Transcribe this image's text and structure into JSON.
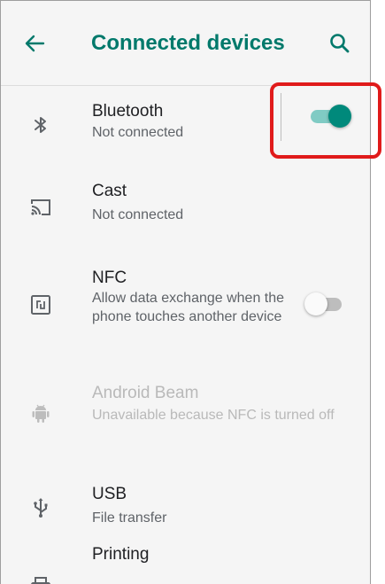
{
  "app_bar": {
    "title": "Connected devices",
    "back_icon": "arrow-back-icon",
    "search_icon": "search-icon",
    "accent_color": "#00796b"
  },
  "items": [
    {
      "icon": "bluetooth-icon",
      "title": "Bluetooth",
      "subtitle": "Not connected",
      "toggle": true
    },
    {
      "icon": "cast-icon",
      "title": "Cast",
      "subtitle": "Not connected"
    },
    {
      "icon": "nfc-icon",
      "title": "NFC",
      "subtitle": "Allow data exchange when the phone touches another device",
      "toggle": false
    },
    {
      "icon": "android-icon",
      "title": "Android Beam",
      "subtitle": "Unavailable because NFC is turned off",
      "disabled": true
    },
    {
      "icon": "usb-icon",
      "title": "USB",
      "subtitle": "File transfer"
    },
    {
      "icon": "printer-icon",
      "title": "Printing",
      "subtitle": ""
    }
  ],
  "colors": {
    "toggle_on_thumb": "#00897b",
    "toggle_on_track": "#80cbc4",
    "toggle_off_thumb": "#fafafa",
    "toggle_off_track": "#bdbdbd",
    "highlight": "#e01b1b"
  }
}
